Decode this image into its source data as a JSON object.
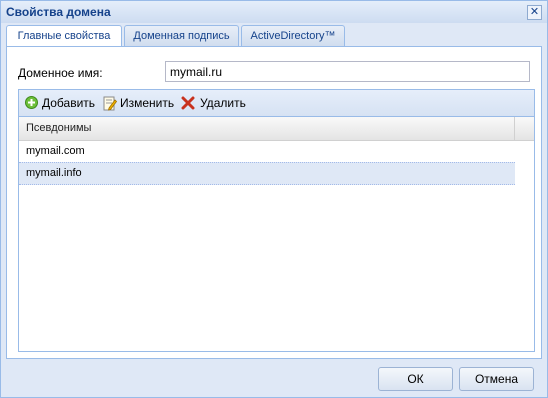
{
  "dialog": {
    "title": "Свойства домена"
  },
  "tabs": [
    {
      "label": "Главные свойства"
    },
    {
      "label": "Доменная подпись"
    },
    {
      "label": "ActiveDirectory™"
    }
  ],
  "form": {
    "domain_label": "Доменное имя:",
    "domain_value": "mymail.ru"
  },
  "toolbar": {
    "add": "Добавить",
    "edit": "Изменить",
    "delete": "Удалить"
  },
  "grid": {
    "column": "Псевдонимы",
    "rows": [
      {
        "alias": "mymail.com"
      },
      {
        "alias": "mymail.info"
      }
    ]
  },
  "buttons": {
    "ok": "ОК",
    "cancel": "Отмена"
  }
}
